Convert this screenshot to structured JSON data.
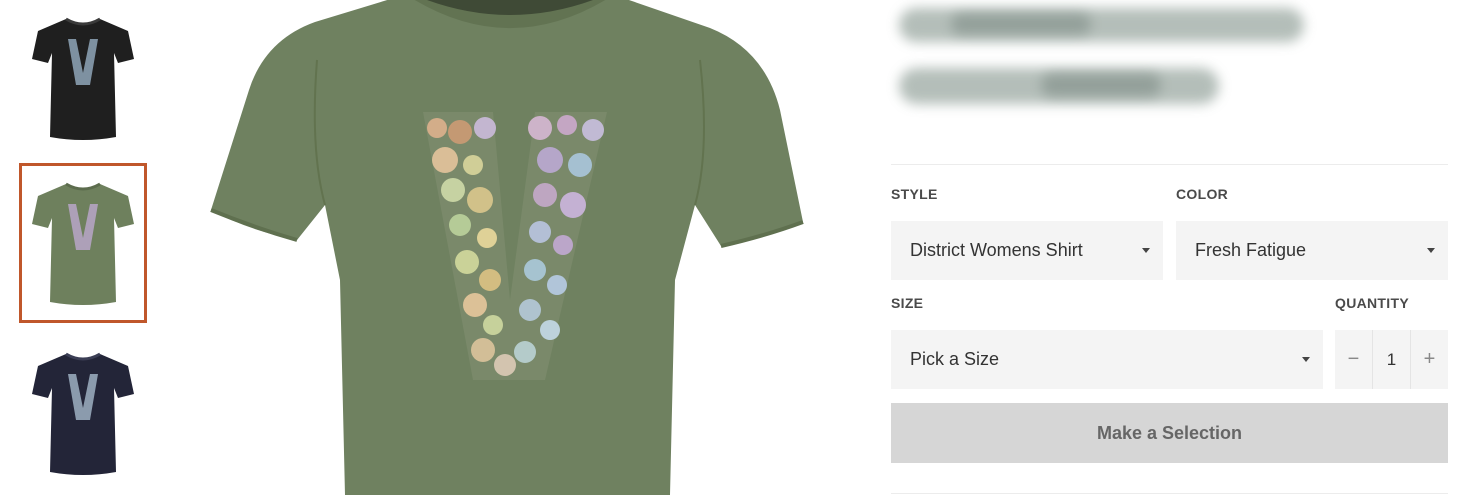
{
  "thumbnails": [
    {
      "name": "black",
      "color": "#1f1f1f"
    },
    {
      "name": "green",
      "color": "#6e805d",
      "selected": true
    },
    {
      "name": "navy",
      "color": "#232538"
    }
  ],
  "main_image": {
    "shirt_color": "#6f8160"
  },
  "style": {
    "label": "STYLE",
    "value": "District Womens Shirt"
  },
  "color": {
    "label": "COLOR",
    "value": "Fresh Fatigue"
  },
  "size": {
    "label": "SIZE",
    "value": "Pick a Size"
  },
  "quantity": {
    "label": "QUANTITY",
    "value": "1",
    "minus": "−",
    "plus": "+"
  },
  "cta": {
    "label": "Make a Selection"
  },
  "colors": {
    "selected_border": "#c0572b",
    "field_bg": "#f4f4f4",
    "button_bg": "#d6d6d6"
  }
}
